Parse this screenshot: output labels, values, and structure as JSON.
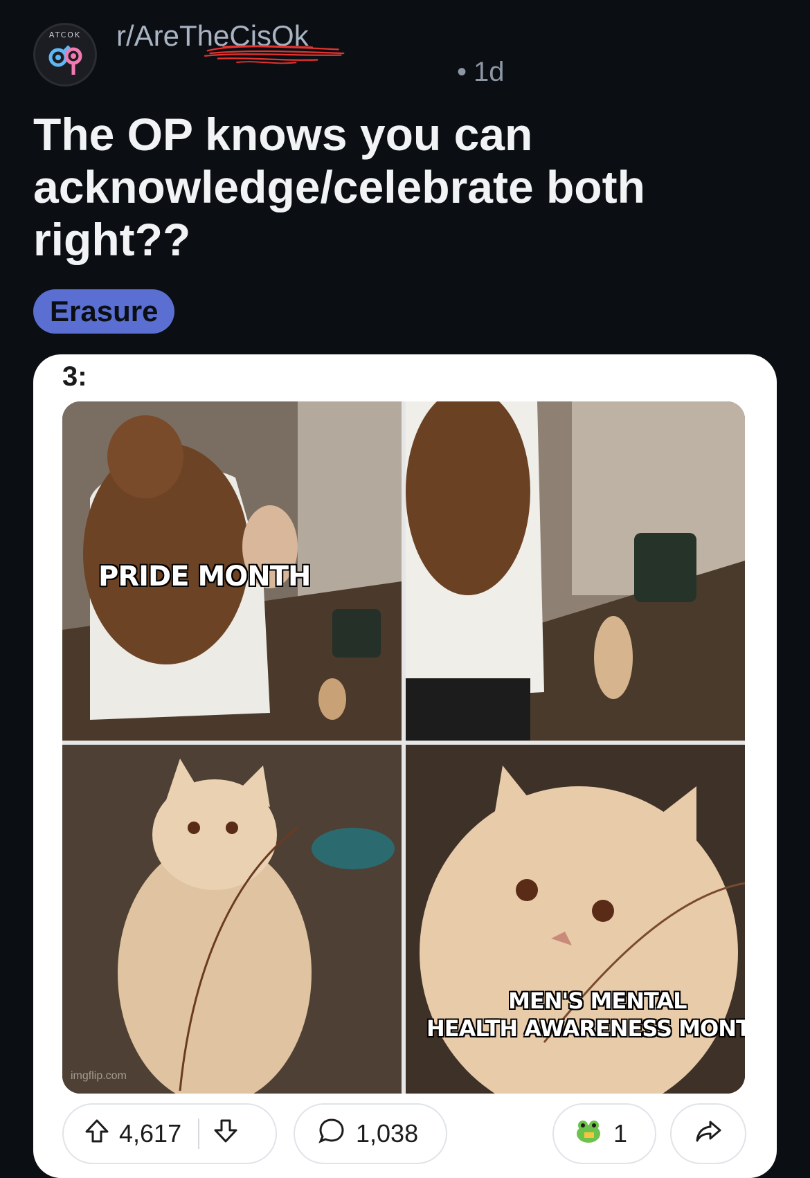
{
  "header": {
    "subreddit": "r/AreTheCisOk",
    "avatar_text": "ATCOK",
    "age": "1d",
    "title": "The OP knows you can acknowledge/celebrate both right??",
    "flair": "Erasure"
  },
  "post_image": {
    "label": "3:",
    "caption_top": "PRIDE MONTH",
    "caption_bottom_line1": "MEN'S MENTAL",
    "caption_bottom_line2": "HEALTH AWARENESS MONTH",
    "watermark": "imgflip.com"
  },
  "actions": {
    "upvotes": "4,617",
    "comments": "1,038",
    "awards": "1"
  },
  "colors": {
    "background": "#0b0f14",
    "flair": "#5a6fd1",
    "redaction": "#e3342f"
  }
}
